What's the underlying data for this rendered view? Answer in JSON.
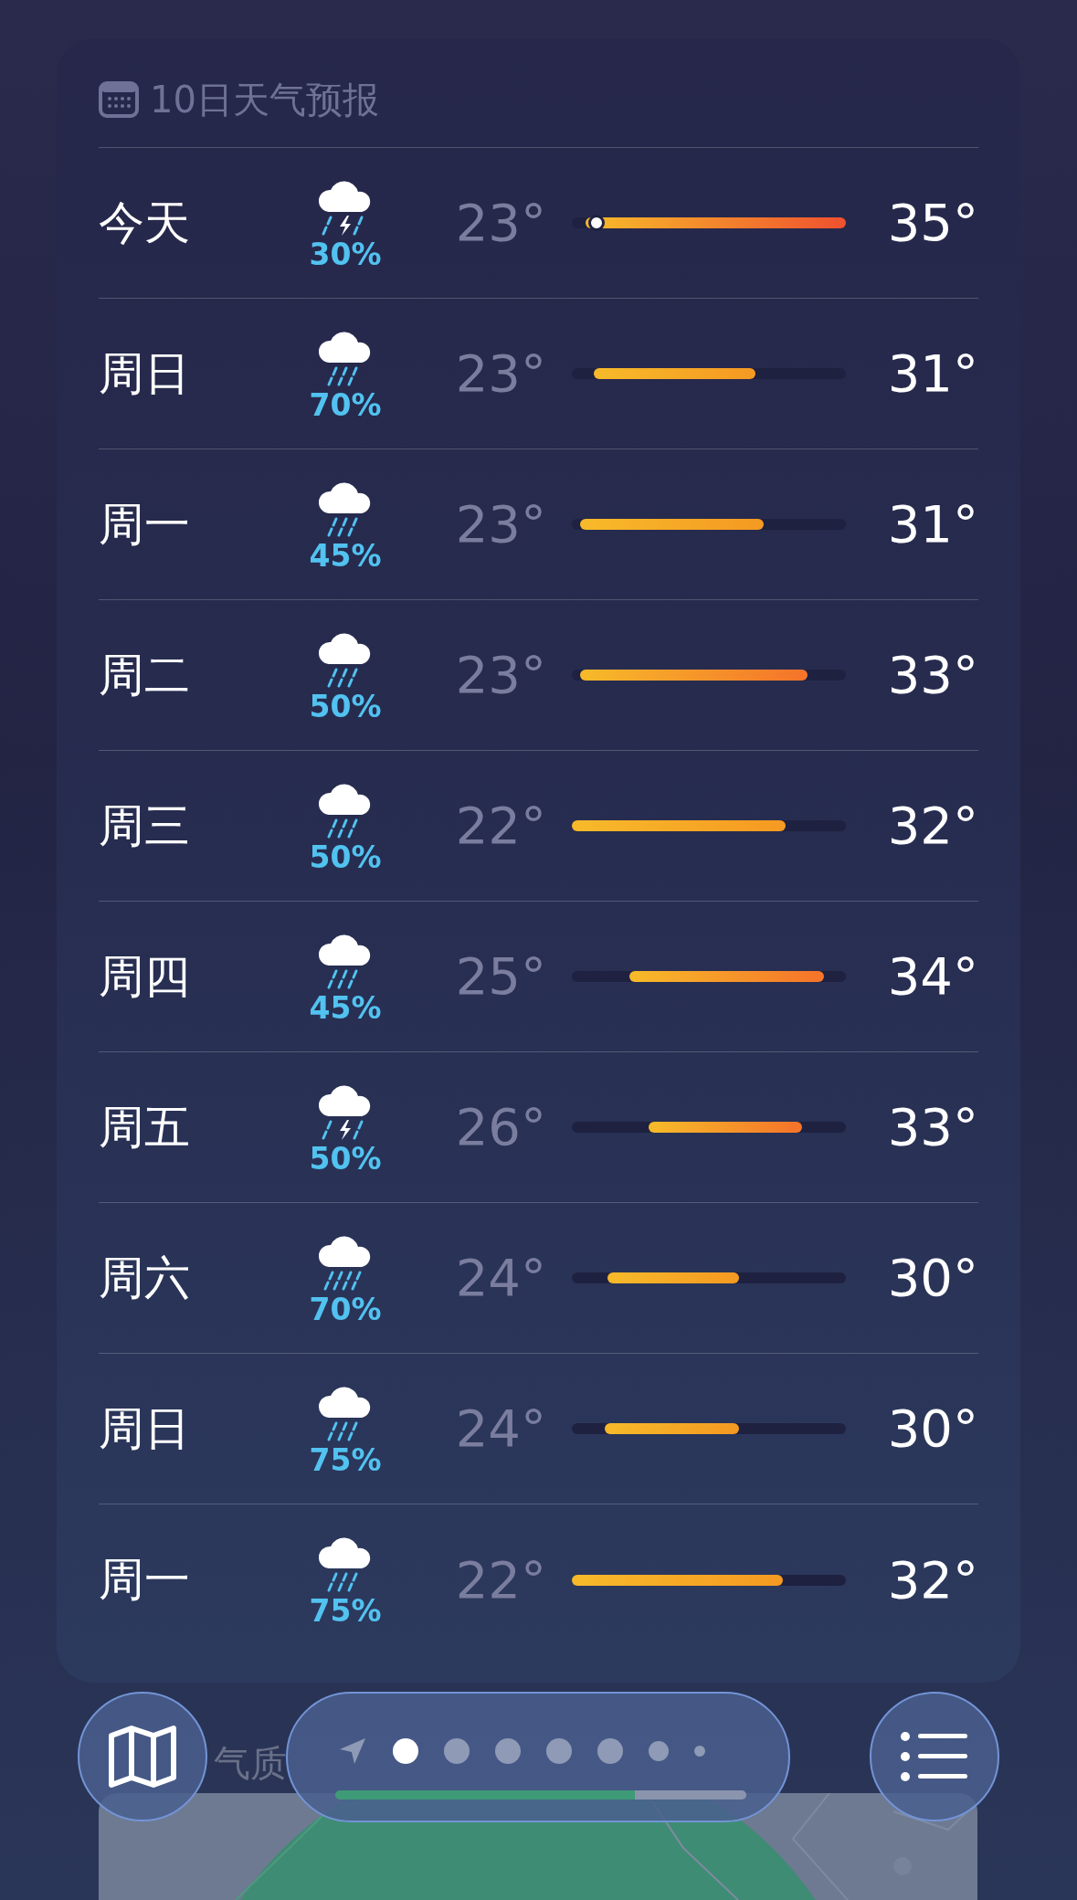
{
  "forecast": {
    "title": "10日天气预报",
    "days": [
      {
        "day": "今天",
        "kind": "thunderstorm",
        "chance": "30%",
        "low": "23°",
        "high": "35°",
        "range_low": {
          "level": 0.05
        },
        "range_high": {
          "level": 1.0
        },
        "now_marker": {
          "level": 0.09
        }
      },
      {
        "day": "周日",
        "kind": "rain",
        "chance": "70%",
        "low": "23°",
        "high": "31°",
        "range_low": {
          "level": 0.08
        },
        "range_high": {
          "level": 0.67
        }
      },
      {
        "day": "周一",
        "kind": "rain",
        "chance": "45%",
        "low": "23°",
        "high": "31°",
        "range_low": {
          "level": 0.03
        },
        "range_high": {
          "level": 0.7
        }
      },
      {
        "day": "周二",
        "kind": "rain",
        "chance": "50%",
        "low": "23°",
        "high": "33°",
        "range_low": {
          "level": 0.03
        },
        "range_high": {
          "level": 0.86
        }
      },
      {
        "day": "周三",
        "kind": "rain",
        "chance": "50%",
        "low": "22°",
        "high": "32°",
        "range_low": {
          "level": 0.0
        },
        "range_high": {
          "level": 0.78
        }
      },
      {
        "day": "周四",
        "kind": "rain",
        "chance": "45%",
        "low": "25°",
        "high": "34°",
        "range_low": {
          "level": 0.21
        },
        "range_high": {
          "level": 0.92
        }
      },
      {
        "day": "周五",
        "kind": "thunderstorm",
        "chance": "50%",
        "low": "26°",
        "high": "33°",
        "range_low": {
          "level": 0.28
        },
        "range_high": {
          "level": 0.84
        }
      },
      {
        "day": "周六",
        "kind": "heavy_rain",
        "chance": "70%",
        "low": "24°",
        "high": "30°",
        "range_low": {
          "level": 0.13
        },
        "range_high": {
          "level": 0.61
        }
      },
      {
        "day": "周日",
        "kind": "rain",
        "chance": "75%",
        "low": "24°",
        "high": "30°",
        "range_low": {
          "level": 0.12
        },
        "range_high": {
          "level": 0.61
        }
      },
      {
        "day": "周一",
        "kind": "rain",
        "chance": "75%",
        "low": "22°",
        "high": "32°",
        "range_low": {
          "level": 0.0
        },
        "range_high": {
          "level": 0.77
        }
      }
    ]
  },
  "next_card": {
    "title": "气质"
  },
  "toolbar": {
    "pages": [
      {
        "kind": "location",
        "selected": false
      },
      {
        "kind": "dot",
        "selected": true
      },
      {
        "kind": "dot",
        "selected": false
      },
      {
        "kind": "dot",
        "selected": false
      },
      {
        "kind": "dot",
        "selected": false
      },
      {
        "kind": "dot",
        "selected": false
      },
      {
        "kind": "small",
        "selected": false
      },
      {
        "kind": "tiny",
        "selected": false
      }
    ]
  }
}
